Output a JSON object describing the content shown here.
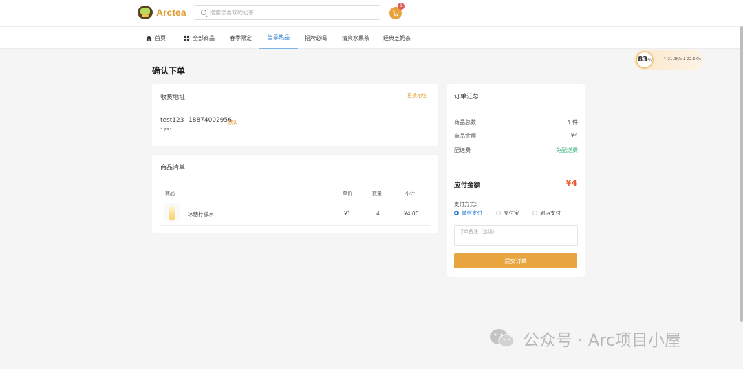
{
  "header": {
    "logo_text": "Arctea",
    "search_placeholder": "搜索您喜欢的奶茶...",
    "cart_count": "1"
  },
  "nav": {
    "items": [
      {
        "label": "首页",
        "icon": "home-icon"
      },
      {
        "label": "全部商品",
        "icon": "grid-icon"
      },
      {
        "label": "春季限定"
      },
      {
        "label": "当季热品"
      },
      {
        "label": "招牌必喝"
      },
      {
        "label": "清爽水果茶"
      },
      {
        "label": "经典芝奶茶"
      }
    ],
    "active_index": 3
  },
  "score": {
    "value": "83",
    "unit": "%",
    "stat_up": "↑ 21.9K/s",
    "stat_down": "↓ 22.6K/s"
  },
  "page": {
    "title": "确认下单"
  },
  "address": {
    "title": "收货地址",
    "change_link": "更换地址",
    "name": "test123",
    "phone": "18874002956",
    "default_tag": "默认",
    "detail": "1231"
  },
  "items": {
    "title": "商品清单",
    "headers": [
      "商品",
      "单价",
      "数量",
      "小计"
    ],
    "rows": [
      {
        "name": "冰糖柠檬水",
        "price": "¥1",
        "qty": "4",
        "subtotal": "¥4.00"
      }
    ]
  },
  "summary": {
    "title": "订单汇总",
    "count_label": "商品总数",
    "count_value": "4 件",
    "amount_label": "商品金额",
    "amount_value": "¥4",
    "shipping_label": "配送费",
    "shipping_value": "免配送费",
    "total_label": "应付金额",
    "total_value": "¥4",
    "pay_label": "支付方式：",
    "pay_options": [
      "微信支付",
      "支付宝",
      "到店支付"
    ],
    "pay_selected": 0,
    "remark_placeholder": "订单备注（选填）",
    "submit_label": "提交订单"
  },
  "watermark": {
    "text": "公众号 · Arc项目小屋"
  },
  "colors": {
    "accent": "#e9a540",
    "link_blue": "#2e7fd3",
    "price_red": "#e85a2e",
    "free_green": "#3db37a"
  }
}
